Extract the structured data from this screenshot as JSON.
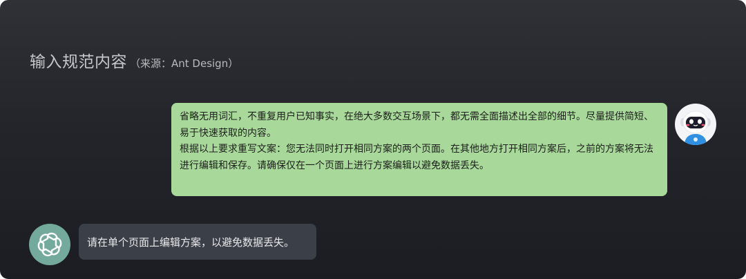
{
  "header": {
    "title": "输入规范内容",
    "source": "（来源：Ant Design）"
  },
  "conversation": {
    "user_message": {
      "paragraphs": [
        "省略无用词汇，不重复用户已知事实，在绝大多数交互场景下，都无需全面描述出全部的细节。尽量提供简短、易于快速获取的内容。",
        "根据以上要求重写文案：您无法同时打开相同方案的两个页面。在其他地方打开相同方案后，之前的方案将无法进行编辑和保存。请确保仅在一个页面上进行方案编辑以避免数据丢失。"
      ],
      "avatar_icon": "robot-avatar-icon"
    },
    "assistant_message": {
      "text": "请在单个页面上编辑方案，以避免数据丢失。",
      "avatar_icon": "openai-logo-icon"
    }
  },
  "colors": {
    "background": "#23252b",
    "user_bubble": "#a8d89a",
    "assistant_bubble": "#3b3f47",
    "assistant_avatar": "#74aa9c",
    "robot_accent": "#2f8fe0"
  }
}
